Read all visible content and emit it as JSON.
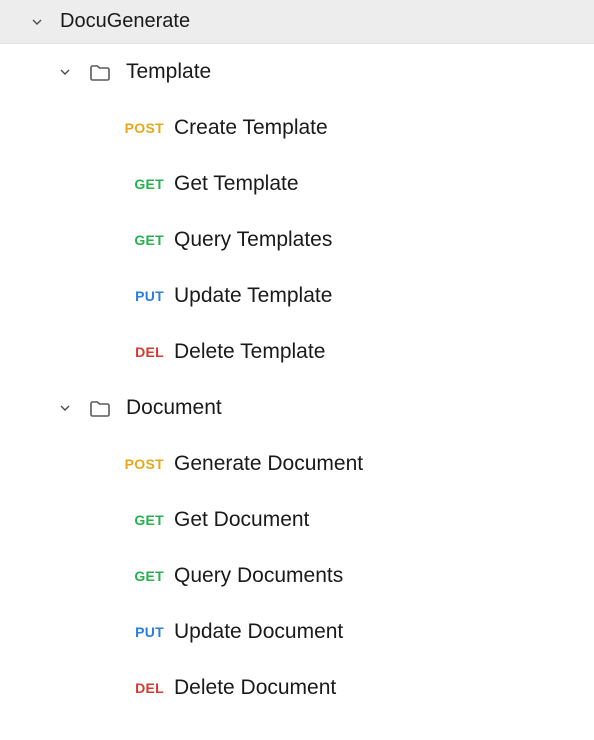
{
  "collection": {
    "name": "DocuGenerate"
  },
  "folders": [
    {
      "name": "Template",
      "requests": [
        {
          "method": "POST",
          "method_class": "method-post",
          "name": "Create Template"
        },
        {
          "method": "GET",
          "method_class": "method-get",
          "name": "Get Template"
        },
        {
          "method": "GET",
          "method_class": "method-get",
          "name": "Query Templates"
        },
        {
          "method": "PUT",
          "method_class": "method-put",
          "name": "Update Template"
        },
        {
          "method": "DEL",
          "method_class": "method-del",
          "name": "Delete Template"
        }
      ]
    },
    {
      "name": "Document",
      "requests": [
        {
          "method": "POST",
          "method_class": "method-post",
          "name": "Generate Document"
        },
        {
          "method": "GET",
          "method_class": "method-get",
          "name": "Get Document"
        },
        {
          "method": "GET",
          "method_class": "method-get",
          "name": "Query Documents"
        },
        {
          "method": "PUT",
          "method_class": "method-put",
          "name": "Update Document"
        },
        {
          "method": "DEL",
          "method_class": "method-del",
          "name": "Delete Document"
        }
      ]
    }
  ]
}
